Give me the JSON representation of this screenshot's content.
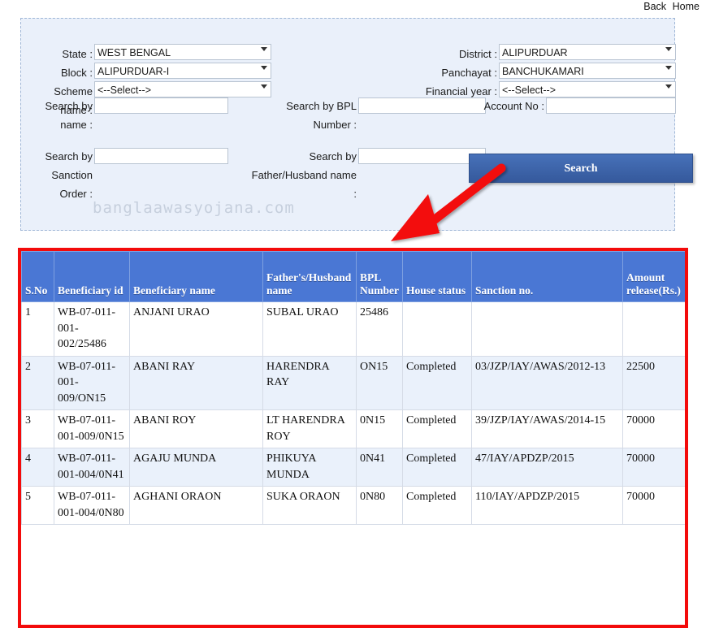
{
  "topbar": {
    "back": "Back",
    "home": "Home"
  },
  "search_panel": {
    "labels": {
      "state": "State :",
      "block": "Block :",
      "scheme_name": "Scheme name :",
      "district": "District :",
      "panchayat": "Panchayat :",
      "financial_year": "Financial year :",
      "search_by_name": "Search by name :",
      "search_by_bpl_number": "Search by BPL Number :",
      "account_no": "Account No :",
      "search_by_sanction_order": "Search by Sanction Order :",
      "search_by_father_husband_name": "Search by Father/Husband name :"
    },
    "values": {
      "state": "WEST BENGAL",
      "block": "ALIPURDUAR-I",
      "scheme_name": "<--Select-->",
      "district": "ALIPURDUAR",
      "panchayat": "BANCHUKAMARI",
      "financial_year": "<--Select-->",
      "search_by_name": "",
      "search_by_bpl_number": "",
      "account_no": "",
      "search_by_sanction_order": "",
      "search_by_father_husband_name": ""
    },
    "search_button": "Search",
    "watermark": "banglaawasyojana.com"
  },
  "results": {
    "columns": [
      "S.No",
      "Beneficiary id",
      "Beneficiary name",
      "Father's/Husband name",
      "BPL Number",
      "House status",
      "Sanction no.",
      "Amount release(Rs.)"
    ],
    "rows": [
      {
        "sno": "1",
        "beneficiary_id": "WB-07-011-001-002/25486",
        "beneficiary_name": "ANJANI URAO",
        "father_husband_name": "SUBAL URAO",
        "bpl_number": "25486",
        "house_status": "",
        "sanction_no": "",
        "amount_release": ""
      },
      {
        "sno": "2",
        "beneficiary_id": "WB-07-011-001-009/ON15",
        "beneficiary_name": "ABANI RAY",
        "father_husband_name": "HARENDRA RAY",
        "bpl_number": "ON15",
        "house_status": "Completed",
        "sanction_no": "03/JZP/IAY/AWAS/2012-13",
        "amount_release": "22500"
      },
      {
        "sno": "3",
        "beneficiary_id": "WB-07-011-001-009/0N15",
        "beneficiary_name": "ABANI ROY",
        "father_husband_name": "LT HARENDRA ROY",
        "bpl_number": "0N15",
        "house_status": "Completed",
        "sanction_no": "39/JZP/IAY/AWAS/2014-15",
        "amount_release": "70000"
      },
      {
        "sno": "4",
        "beneficiary_id": "WB-07-011-001-004/0N41",
        "beneficiary_name": "AGAJU MUNDA",
        "father_husband_name": "PHIKUYA MUNDA",
        "bpl_number": "0N41",
        "house_status": "Completed",
        "sanction_no": "47/IAY/APDZP/2015",
        "amount_release": "70000"
      },
      {
        "sno": "5",
        "beneficiary_id": "WB-07-011-001-004/0N80",
        "beneficiary_name": "AGHANI ORAON",
        "father_husband_name": "SUKA ORAON",
        "bpl_number": "0N80",
        "house_status": "Completed",
        "sanction_no": "110/IAY/APDZP/2015",
        "amount_release": "70000"
      }
    ]
  },
  "colors": {
    "header_blue": "#4a77d4",
    "row_tint": "#eaf1fb",
    "panel_bg": "#eaf0fa",
    "annotation_red": "#f30b0b",
    "button_blue": "#3b62a8"
  }
}
